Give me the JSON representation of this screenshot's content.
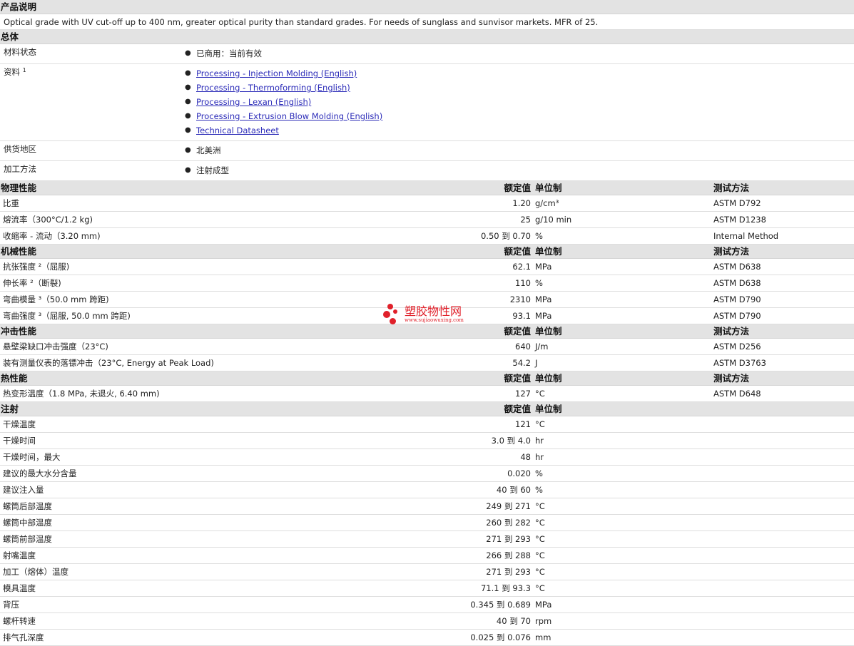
{
  "header_desc": "产品说明",
  "description": "Optical grade with UV cut-off up to 400 nm, greater optical purity than standard grades. For needs of sunglass and sunvisor markets. MFR of 25.",
  "general": {
    "title": "总体",
    "rows": [
      {
        "label": "材料状态",
        "sup": "",
        "items": [
          {
            "text": "已商用：当前有效",
            "link": false
          }
        ]
      },
      {
        "label": "资料",
        "sup": "1",
        "items": [
          {
            "text": "Processing - Injection Molding (English)",
            "link": true
          },
          {
            "text": "Processing - Thermoforming (English)",
            "link": true
          },
          {
            "text": "Processing - Lexan (English)",
            "link": true
          },
          {
            "text": "Processing - Extrusion Blow Molding (English)",
            "link": true
          },
          {
            "text": "Technical Datasheet",
            "link": true
          }
        ]
      },
      {
        "label": "供货地区",
        "sup": "",
        "items": [
          {
            "text": "北美洲",
            "link": false
          }
        ]
      },
      {
        "label": "加工方法",
        "sup": "",
        "items": [
          {
            "text": "注射成型",
            "link": false
          }
        ]
      }
    ]
  },
  "sections": [
    {
      "title": "物理性能",
      "h_value": "额定值",
      "h_unit": "单位制",
      "h_test": "测试方法",
      "rows": [
        {
          "label": "比重",
          "value": "1.20",
          "unit": "g/cm³",
          "test": "ASTM D792"
        },
        {
          "label": "熔流率（300°C/1.2 kg)",
          "value": "25",
          "unit": "g/10 min",
          "test": "ASTM D1238"
        },
        {
          "label": "收缩率 - 流动（3.20 mm)",
          "value": "0.50 到 0.70",
          "unit": "%",
          "test": "Internal Method"
        }
      ]
    },
    {
      "title": "机械性能",
      "h_value": "额定值",
      "h_unit": "单位制",
      "h_test": "测试方法",
      "rows": [
        {
          "label": "抗张强度 ²（屈服)",
          "value": "62.1",
          "unit": "MPa",
          "test": "ASTM D638"
        },
        {
          "label": "伸长率 ²（断裂)",
          "value": "110",
          "unit": "%",
          "test": "ASTM D638"
        },
        {
          "label": "弯曲模量 ³（50.0 mm 跨距)",
          "value": "2310",
          "unit": "MPa",
          "test": "ASTM D790"
        },
        {
          "label": "弯曲强度 ³（屈服, 50.0 mm 跨距)",
          "value": "93.1",
          "unit": "MPa",
          "test": "ASTM D790"
        }
      ]
    },
    {
      "title": "冲击性能",
      "h_value": "额定值",
      "h_unit": "单位制",
      "h_test": "测试方法",
      "rows": [
        {
          "label": "悬壁梁缺口冲击强度（23°C)",
          "value": "640",
          "unit": "J/m",
          "test": "ASTM D256"
        },
        {
          "label": "装有测量仪表的落镖冲击（23°C, Energy at Peak Load)",
          "value": "54.2",
          "unit": "J",
          "test": "ASTM D3763"
        }
      ]
    },
    {
      "title": "热性能",
      "h_value": "额定值",
      "h_unit": "单位制",
      "h_test": "测试方法",
      "rows": [
        {
          "label": "热变形温度（1.8 MPa, 未退火, 6.40 mm)",
          "value": "127",
          "unit": "°C",
          "test": "ASTM D648"
        }
      ]
    },
    {
      "title": "注射",
      "h_value": "额定值",
      "h_unit": "单位制",
      "h_test": "",
      "rows": [
        {
          "label": "干燥温度",
          "value": "121",
          "unit": "°C",
          "test": ""
        },
        {
          "label": "干燥时间",
          "value": "3.0 到 4.0",
          "unit": "hr",
          "test": ""
        },
        {
          "label": "干燥时间，最大",
          "value": "48",
          "unit": "hr",
          "test": ""
        },
        {
          "label": "建议的最大水分含量",
          "value": "0.020",
          "unit": "%",
          "test": ""
        },
        {
          "label": "建议注入量",
          "value": "40 到 60",
          "unit": "%",
          "test": ""
        },
        {
          "label": "螺筒后部温度",
          "value": "249 到 271",
          "unit": "°C",
          "test": ""
        },
        {
          "label": "螺筒中部温度",
          "value": "260 到 282",
          "unit": "°C",
          "test": ""
        },
        {
          "label": "螺筒前部温度",
          "value": "271 到 293",
          "unit": "°C",
          "test": ""
        },
        {
          "label": "射嘴温度",
          "value": "266 到 288",
          "unit": "°C",
          "test": ""
        },
        {
          "label": "加工（熔体）温度",
          "value": "271 到 293",
          "unit": "°C",
          "test": ""
        },
        {
          "label": "模具温度",
          "value": "71.1 到 93.3",
          "unit": "°C",
          "test": ""
        },
        {
          "label": "背压",
          "value": "0.345 到 0.689",
          "unit": "MPa",
          "test": ""
        },
        {
          "label": "螺杆转速",
          "value": "40 到 70",
          "unit": "rpm",
          "test": ""
        },
        {
          "label": "排气孔深度",
          "value": "0.025 到 0.076",
          "unit": "mm",
          "test": ""
        }
      ]
    }
  ],
  "watermark": {
    "cn": "塑胶物性网",
    "en": "www.sujiaowuxing.com",
    "color": "#e0202a"
  }
}
